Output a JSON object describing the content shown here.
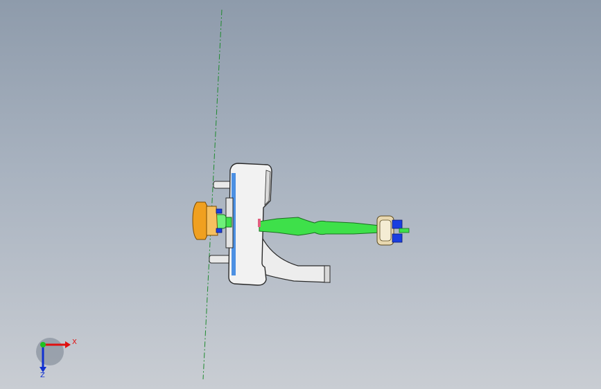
{
  "viewport": {
    "background_top": "#8e9bab",
    "background_bottom": "#c9cdd3"
  },
  "model": {
    "body_color": "#f2f2f2",
    "edge_color": "#2a2a2a",
    "shaft_color": "#3ee04a",
    "knob_left_color": "#f0a020",
    "knob_right_color": "#e8d8b0",
    "face_accent_color": "#2f7fe0",
    "pin_color": "#1a3ee0",
    "sketch_line_color": "#1e8a2e"
  },
  "triad": {
    "x_label": "X",
    "z_label": "Z",
    "x_color": "#e01010",
    "y_color": "#20c020",
    "z_color": "#1030d0"
  }
}
